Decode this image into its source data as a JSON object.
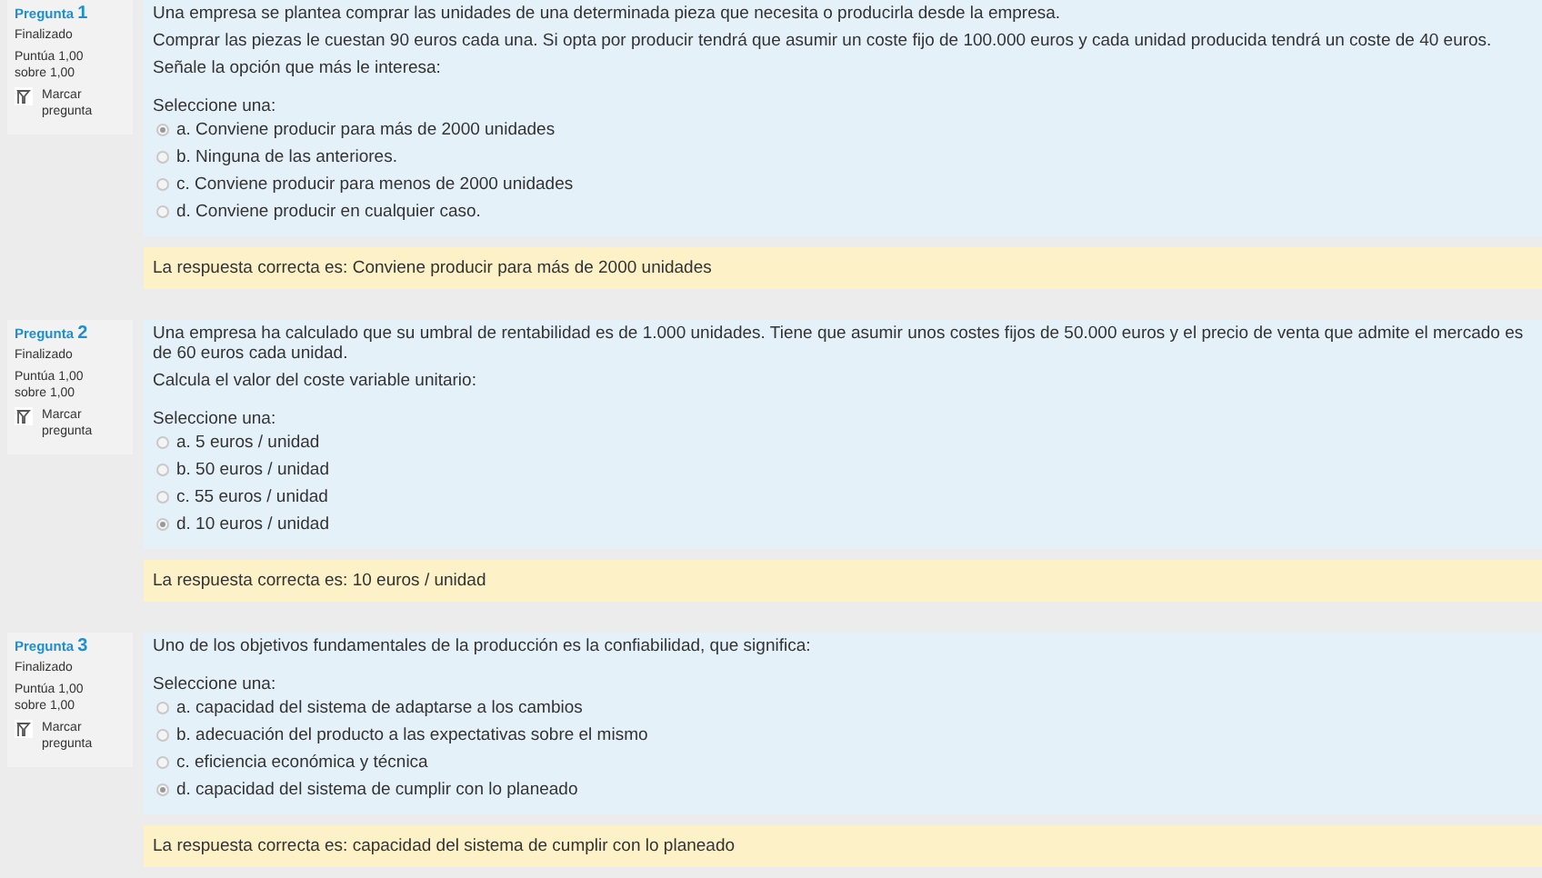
{
  "questions": [
    {
      "label": "Pregunta",
      "number": "1",
      "status": "Finalizado",
      "score": "Puntúa 1,00 sobre 1,00",
      "flag": "Marcar pregunta",
      "text": [
        "Una empresa se plantea comprar las unidades de una determinada pieza que necesita o producirla desde la empresa.",
        "Comprar las piezas le cuestan 90 euros cada una. Si opta por producir tendrá que asumir un coste fijo de 100.000 euros y cada unidad producida tendrá un coste de 40 euros.",
        "Señale la opción que más le interesa:"
      ],
      "prompt": "Seleccione una:",
      "options": [
        {
          "text": "a. Conviene producir para más de 2000 unidades",
          "selected": true
        },
        {
          "text": "b. Ninguna de las anteriores.",
          "selected": false
        },
        {
          "text": "c. Conviene producir para menos de 2000 unidades",
          "selected": false
        },
        {
          "text": "d. Conviene producir en cualquier caso.",
          "selected": false
        }
      ],
      "feedback": "La respuesta correcta es: Conviene producir para más de 2000 unidades"
    },
    {
      "label": "Pregunta",
      "number": "2",
      "status": "Finalizado",
      "score": "Puntúa 1,00 sobre 1,00",
      "flag": "Marcar pregunta",
      "text": [
        "Una empresa ha calculado que su umbral de rentabilidad es de 1.000 unidades. Tiene que asumir unos costes fijos de 50.000 euros y el precio de venta que admite el mercado es de 60 euros cada unidad.",
        "Calcula el valor del coste variable unitario:"
      ],
      "prompt": "Seleccione una:",
      "options": [
        {
          "text": "a. 5 euros / unidad",
          "selected": false
        },
        {
          "text": "b. 50 euros / unidad",
          "selected": false
        },
        {
          "text": "c. 55 euros / unidad",
          "selected": false
        },
        {
          "text": "d. 10 euros / unidad",
          "selected": true
        }
      ],
      "feedback": "La respuesta correcta es: 10 euros / unidad"
    },
    {
      "label": "Pregunta",
      "number": "3",
      "status": "Finalizado",
      "score": "Puntúa 1,00 sobre 1,00",
      "flag": "Marcar pregunta",
      "text": [
        "Uno de los objetivos fundamentales de la producción es la confiabilidad, que significa:"
      ],
      "prompt": "Seleccione una:",
      "options": [
        {
          "text": "a. capacidad del sistema de adaptarse a los cambios",
          "selected": false
        },
        {
          "text": "b. adecuación del producto a las expectativas sobre el mismo",
          "selected": false
        },
        {
          "text": "c. eficiencia económica y técnica",
          "selected": false
        },
        {
          "text": "d. capacidad del sistema de cumplir con lo planeado",
          "selected": true
        }
      ],
      "feedback": "La respuesta correcta es: capacidad del sistema de cumplir con lo planeado"
    }
  ]
}
